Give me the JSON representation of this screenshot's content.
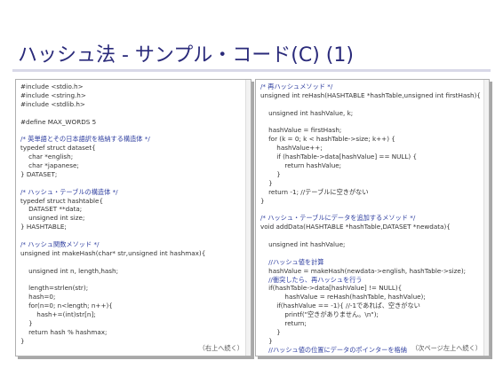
{
  "slide": {
    "title": "ハッシュ法 - サンプル・コード(C) (1)"
  },
  "left_panel": {
    "lines": [
      {
        "text": "#include <stdio.h>",
        "comment": false
      },
      {
        "text": "#include <string.h>",
        "comment": false
      },
      {
        "text": "#include <stdlib.h>",
        "comment": false
      },
      {
        "text": "",
        "comment": false
      },
      {
        "text": "#define MAX_WORDS 5",
        "comment": false
      },
      {
        "text": "",
        "comment": false
      },
      {
        "text": "/* 英単語とその日本語訳を格納する構造体 */",
        "comment": true
      },
      {
        "text": "typedef struct dataset{",
        "comment": false
      },
      {
        "text": "    char *english;",
        "comment": false
      },
      {
        "text": "    char *japanese;",
        "comment": false
      },
      {
        "text": "} DATASET;",
        "comment": false
      },
      {
        "text": "",
        "comment": false
      },
      {
        "text": "/* ハッシュ・テーブルの構造体 */",
        "comment": true
      },
      {
        "text": "typedef struct hashtable{",
        "comment": false
      },
      {
        "text": "    DATASET **data;",
        "comment": false
      },
      {
        "text": "    unsigned int size;",
        "comment": false
      },
      {
        "text": "} HASHTABLE;",
        "comment": false
      },
      {
        "text": "",
        "comment": false
      },
      {
        "text": "/* ハッシュ関数メソッド */",
        "comment": true
      },
      {
        "text": "unsigned int makeHash(char* str,unsigned int hashmax){",
        "comment": false
      },
      {
        "text": "",
        "comment": false
      },
      {
        "text": "    unsigned int n, length,hash;",
        "comment": false
      },
      {
        "text": "",
        "comment": false
      },
      {
        "text": "    length=strlen(str);",
        "comment": false
      },
      {
        "text": "    hash=0;",
        "comment": false
      },
      {
        "text": "    for(n=0; n<length; n++){",
        "comment": false
      },
      {
        "text": "        hash+=(int)str[n];",
        "comment": false
      },
      {
        "text": "    }",
        "comment": false
      },
      {
        "text": "    return hash % hashmax;",
        "comment": false
      },
      {
        "text": "}",
        "comment": false
      }
    ],
    "continuation": "（右上へ続く）"
  },
  "right_panel": {
    "lines": [
      {
        "text": "/* 再ハッシュメソッド */",
        "comment": true
      },
      {
        "text": "unsigned int reHash(HASHTABLE *hashTable,unsigned int firstHash){",
        "comment": false
      },
      {
        "text": "",
        "comment": false
      },
      {
        "text": "    unsigned int hashValue, k;",
        "comment": false
      },
      {
        "text": "",
        "comment": false
      },
      {
        "text": "    hashValue = firstHash;",
        "comment": false
      },
      {
        "text": "    for (k = 0; k < hashTable->size; k++) {",
        "comment": false
      },
      {
        "text": "        hashValue++;",
        "comment": false
      },
      {
        "text": "        if (hashTable->data[hashValue] == NULL) {",
        "comment": false
      },
      {
        "text": "            return hashValue;",
        "comment": false
      },
      {
        "text": "        }",
        "comment": false
      },
      {
        "text": "    }",
        "comment": false
      },
      {
        "text": "    return -1; //テーブルに空きがない",
        "comment": false
      },
      {
        "text": "}",
        "comment": false
      },
      {
        "text": "",
        "comment": false
      },
      {
        "text": "/* ハッシュ・テーブルにデータを追加するメソッド */",
        "comment": true
      },
      {
        "text": "void addData(HASHTABLE *hashTable,DATASET *newdata){",
        "comment": false
      },
      {
        "text": "",
        "comment": false
      },
      {
        "text": "    unsigned int hashValue;",
        "comment": false
      },
      {
        "text": "",
        "comment": false
      },
      {
        "text": "    //ハッシュ値を計算",
        "comment": true
      },
      {
        "text": "    hashValue = makeHash(newdata->english, hashTable->size);",
        "comment": false
      },
      {
        "text": "    //衝突したら、再ハッシュを行う",
        "comment": true
      },
      {
        "text": "    if(hashTable->data[hashValue] != NULL){",
        "comment": false
      },
      {
        "text": "            hashValue = reHash(hashTable, hashValue);",
        "comment": false
      },
      {
        "text": "        if(hashValue == -1){ //-1であれば、空きがない",
        "comment": false
      },
      {
        "text": "            printf(\"空きがありません。\\n\");",
        "comment": false
      },
      {
        "text": "            return;",
        "comment": false
      },
      {
        "text": "        }",
        "comment": false
      },
      {
        "text": "    }",
        "comment": false
      },
      {
        "text": "    //ハッシュ値の位置にデータのポインターを格納",
        "comment": true
      },
      {
        "text": "    hashTable->data[hashValue]=newdata;",
        "comment": false
      },
      {
        "text": "}",
        "comment": false
      }
    ],
    "continuation": "（次ページ左上へ続く）"
  },
  "colors": {
    "title": "#2a2a7a",
    "comment": "#2f3fa0",
    "code": "#333333"
  }
}
